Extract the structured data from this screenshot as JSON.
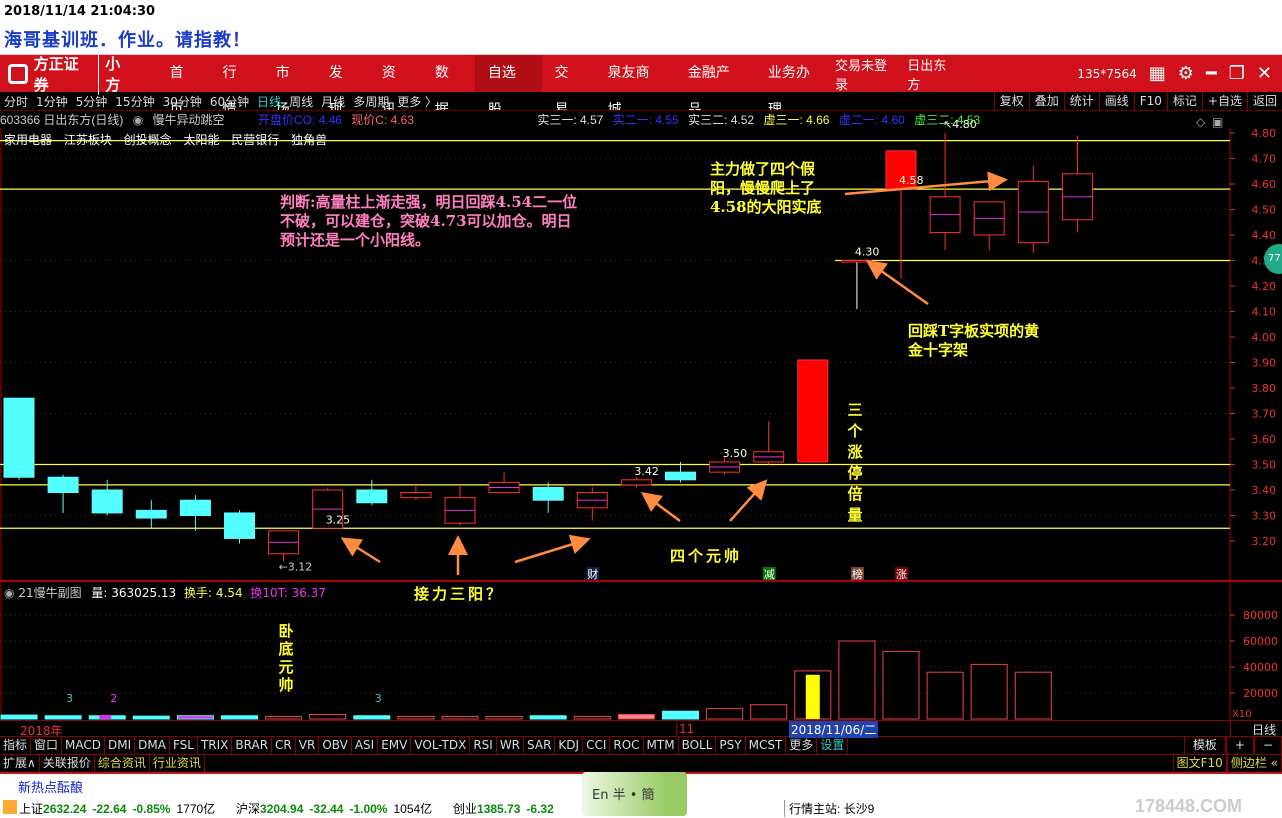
{
  "title": {
    "datetime": "2018/11/14 21:04:30",
    "text": "海哥基训班．作业。请指教！"
  },
  "menu": {
    "brand": "方正证券",
    "brand_sub": "小方",
    "items": [
      "首页",
      "行情",
      "市场",
      "发现",
      "资讯",
      "数据",
      "自选股",
      "交易",
      "泉友商城",
      "金融产品",
      "业务办理"
    ],
    "active": "自选股",
    "login": "交易未登录",
    "stock": "日出东方",
    "account": "135*7564"
  },
  "periods": {
    "items": [
      "分时",
      "1分钟",
      "5分钟",
      "15分钟",
      "30分钟",
      "60分钟",
      "日线",
      "周线",
      "月线",
      "多周期",
      "更多 〉"
    ],
    "active": "日线",
    "tools": [
      "复权",
      "叠加",
      "统计",
      "画线",
      "F10",
      "标记",
      "+自选",
      "返回"
    ]
  },
  "info": {
    "code_name": "603366 日出东方(日线)",
    "indicator": "慢牛异动跳空",
    "open": "开盘价CO: 4.46",
    "now": "现价C: 4.63",
    "s31": "实三一: 4.57",
    "s21": "实二一: 4.55",
    "s32": "实三二: 4.52",
    "x31": "虚三一: 4.66",
    "x21": "虚二一: 4.60",
    "x32": "虚三二: 4.53",
    "tags": "家用电器 江苏板块 创投概念 太阳能 民营银行 独角兽",
    "side_badge": "77"
  },
  "colors": {
    "up": "#ff3030",
    "down": "#54ffff",
    "line": "#ffff40",
    "arrow": "#ff8c40",
    "pink": "#ff80c0",
    "yellow": "#ffff30"
  },
  "chart_data": {
    "type": "candlestick",
    "price_ticks": [
      "4.80",
      "4.70",
      "4.60",
      "4.50",
      "4.40",
      "4.30",
      "4.20",
      "4.10",
      "4.00",
      "3.90",
      "3.80",
      "3.70",
      "3.60",
      "3.50",
      "3.40",
      "3.30",
      "3.20"
    ],
    "ylim": [
      3.15,
      4.83
    ],
    "candles": [
      {
        "o": 3.76,
        "h": 3.76,
        "l": 3.44,
        "c": 3.45
      },
      {
        "o": 3.45,
        "h": 3.46,
        "l": 3.31,
        "c": 3.39
      },
      {
        "o": 3.4,
        "h": 3.44,
        "l": 3.3,
        "c": 3.31
      },
      {
        "o": 3.32,
        "h": 3.36,
        "l": 3.25,
        "c": 3.29
      },
      {
        "o": 3.36,
        "h": 3.38,
        "l": 3.24,
        "c": 3.3
      },
      {
        "o": 3.31,
        "h": 3.32,
        "l": 3.19,
        "c": 3.21
      },
      {
        "o": 3.15,
        "h": 3.24,
        "l": 3.12,
        "c": 3.24
      },
      {
        "o": 3.25,
        "h": 3.41,
        "l": 3.25,
        "c": 3.4
      },
      {
        "o": 3.4,
        "h": 3.44,
        "l": 3.34,
        "c": 3.35
      },
      {
        "o": 3.37,
        "h": 3.42,
        "l": 3.36,
        "c": 3.39
      },
      {
        "o": 3.27,
        "h": 3.42,
        "l": 3.26,
        "c": 3.37
      },
      {
        "o": 3.39,
        "h": 3.47,
        "l": 3.39,
        "c": 3.43
      },
      {
        "o": 3.41,
        "h": 3.43,
        "l": 3.31,
        "c": 3.36
      },
      {
        "o": 3.33,
        "h": 3.41,
        "l": 3.28,
        "c": 3.39
      },
      {
        "o": 3.42,
        "h": 3.45,
        "l": 3.41,
        "c": 3.44
      },
      {
        "o": 3.47,
        "h": 3.51,
        "l": 3.43,
        "c": 3.44
      },
      {
        "o": 3.47,
        "h": 3.53,
        "l": 3.46,
        "c": 3.51
      },
      {
        "o": 3.51,
        "h": 3.67,
        "l": 3.5,
        "c": 3.55
      },
      {
        "o": 3.51,
        "h": 3.91,
        "l": 3.51,
        "c": 3.91
      },
      {
        "o": 4.3,
        "h": 4.3,
        "l": 4.11,
        "c": 4.3
      },
      {
        "o": 4.58,
        "h": 4.73,
        "l": 4.23,
        "c": 4.73
      },
      {
        "o": 4.41,
        "h": 4.8,
        "l": 4.34,
        "c": 4.55
      },
      {
        "o": 4.4,
        "h": 4.53,
        "l": 4.34,
        "c": 4.53
      },
      {
        "o": 4.37,
        "h": 4.67,
        "l": 4.33,
        "c": 4.61
      },
      {
        "o": 4.46,
        "h": 4.79,
        "l": 4.41,
        "c": 4.64
      }
    ],
    "price_labels": [
      {
        "i": 6,
        "p": 3.12,
        "t": "←3.12"
      },
      {
        "i": 7,
        "p": 3.25,
        "t": "3.25"
      },
      {
        "i": 14,
        "p": 3.44,
        "t": "3.42"
      },
      {
        "i": 16,
        "p": 3.51,
        "t": "3.50"
      },
      {
        "i": 19,
        "p": 4.3,
        "t": "4.30"
      },
      {
        "i": 20,
        "p": 4.58,
        "t": "4.58"
      },
      {
        "i": 21,
        "p": 4.8,
        "t": "↖4.80"
      }
    ],
    "support_lines": [
      4.77,
      4.58,
      4.3,
      3.5,
      3.42,
      3.25
    ],
    "volume": {
      "header": {
        "name": "21慢牛副图",
        "vol": "量: 363025.13",
        "turnover": "换手: 4.54",
        "t10": "换10T: 36.37"
      },
      "ticks": [
        "80000",
        "60000",
        "40000",
        "20000"
      ],
      "unit": "X10",
      "max": 100000,
      "values": [
        3000,
        2500,
        2500,
        2200,
        2500,
        2500,
        2000,
        3500,
        2500,
        2000,
        2000,
        2000,
        2500,
        2000,
        3500,
        6000,
        8000,
        11000,
        37000,
        60000,
        52000,
        36000,
        42000,
        36000,
        0
      ],
      "marks": [
        {
          "i": 1,
          "t": "3",
          "c": "#3cc"
        },
        {
          "i": 2,
          "t": "2",
          "c": "#f3f"
        },
        {
          "i": 8,
          "t": "3",
          "c": "#3cc"
        }
      ]
    },
    "date_labels": {
      "year": "2018年",
      "month": "11",
      "cursor": "2018/11/06/二",
      "period": "日线"
    },
    "signals": [
      {
        "i": 13,
        "t": "财",
        "bg": "#124"
      },
      {
        "i": 17,
        "t": "减",
        "bg": "#070"
      },
      {
        "i": 19,
        "t": "榜",
        "bg": "#743"
      },
      {
        "i": 20,
        "t": "涨",
        "bg": "#700"
      }
    ]
  },
  "annotations": {
    "judge": "判断:高量柱上渐走强，明日回踩4.54二一位不破，可以建仓，突破4.73可以加仓。明日预计还是一个小阳线。",
    "main_force": "主力做了四个假阳，慢慢爬上了4.58的大阳实底",
    "pullback": "回踩T字板实项的黄金十字架",
    "three_limit": "三个涨停倍量",
    "four_yuanshuai": "四个元帅",
    "relay": "接力三阳？",
    "bottom": "卧底元帅"
  },
  "indicators": {
    "items": [
      "指标",
      "窗口",
      "MACD",
      "DMI",
      "DMA",
      "FSL",
      "TRIX",
      "BRAR",
      "CR",
      "VR",
      "OBV",
      "ASI",
      "EMV",
      "VOL-TDX",
      "RSI",
      "WR",
      "SAR",
      "KDJ",
      "CCI",
      "ROC",
      "MTM",
      "BOLL",
      "PSY",
      "MCST",
      "更多",
      "设置"
    ],
    "right": [
      "模板",
      "+",
      "−"
    ]
  },
  "ext": {
    "items": [
      "扩展∧",
      "关联报价",
      "综合资讯",
      "行业资讯"
    ],
    "right": [
      "图文F10",
      "侧边栏 «"
    ]
  },
  "news": {
    "text": "新热点酝酿",
    "ime": "En 半 • 簡"
  },
  "status": {
    "sh_name": "上证",
    "sh": "2632.24",
    "sh_chg": "-22.64",
    "sh_pct": "-0.85%",
    "sh_amt": "1770亿",
    "sz_name": "沪深",
    "sz": "3204.94",
    "sz_chg": "-32.44",
    "sz_pct": "-1.00%",
    "sz_amt": "1054亿",
    "cy_name": "创业",
    "cy": "1385.73",
    "cy_chg": "-6.32",
    "server": "行情主站: 长沙9",
    "watermark": "178448.COM"
  }
}
